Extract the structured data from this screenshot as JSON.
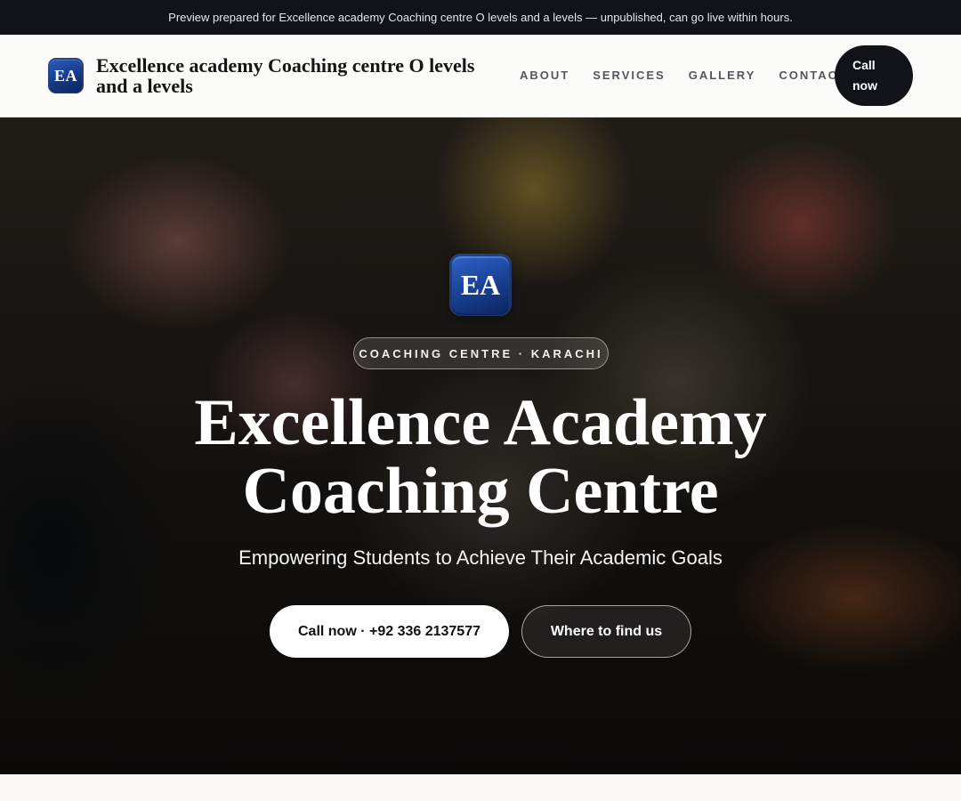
{
  "topbar": {
    "notice": "Preview prepared for Excellence academy Coaching centre O levels and a levels — unpublished, can go live within hours."
  },
  "header": {
    "logo_text": "EA",
    "brand_name": "Excellence academy Coaching centre O levels and a levels",
    "nav": [
      "ABOUT",
      "SERVICES",
      "GALLERY",
      "CONTACT"
    ],
    "call_label": "Call now"
  },
  "hero": {
    "logo_text": "EA",
    "badge": "COACHING CENTRE · KARACHI",
    "title": "Excellence Academy Coaching Centre",
    "subtitle": "Empowering Students to Achieve Their Academic Goals",
    "primary_cta": "Call now · +92 336 2137577",
    "secondary_cta": "Where to find us"
  },
  "colors": {
    "topbar_bg": "#111318",
    "brand_blue": "#163a86",
    "button_dark": "#111318",
    "page_bg": "#faf9f6"
  }
}
